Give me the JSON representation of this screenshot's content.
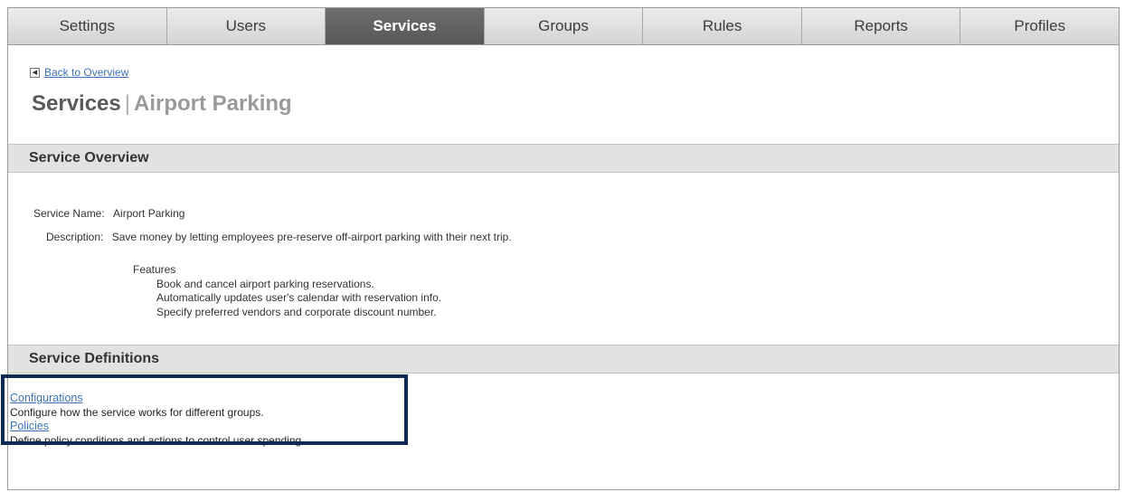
{
  "tabs": [
    {
      "label": "Settings",
      "active": false
    },
    {
      "label": "Users",
      "active": false
    },
    {
      "label": "Services",
      "active": true
    },
    {
      "label": "Groups",
      "active": false
    },
    {
      "label": "Rules",
      "active": false
    },
    {
      "label": "Reports",
      "active": false
    },
    {
      "label": "Profiles",
      "active": false
    }
  ],
  "back_link": {
    "label": "Back to Overview",
    "icon": "arrow-left-icon"
  },
  "page_title": {
    "main": "Services",
    "separator": "|",
    "sub": "Airport Parking"
  },
  "overview": {
    "heading": "Service Overview",
    "service_name_label": "Service Name:",
    "service_name_value": "Airport Parking",
    "description_label": "Description:",
    "description_value": "Save money by letting employees pre-reserve off-airport parking with their next trip.",
    "features_heading": "Features",
    "features": [
      "Book and cancel airport parking reservations.",
      "Automatically updates user's calendar with reservation info.",
      "Specify preferred vendors and corporate discount number."
    ]
  },
  "definitions": {
    "heading": "Service Definitions",
    "items": [
      {
        "link": "Configurations",
        "description": "Configure how the service works for different groups."
      },
      {
        "link": "Policies",
        "description": "Define policy conditions and actions to control user spending"
      }
    ]
  },
  "colors": {
    "active_tab": "#5f5f5f",
    "link": "#3b73b9",
    "highlight_border": "#0d2a52",
    "section_bar": "#e2e2e2"
  }
}
